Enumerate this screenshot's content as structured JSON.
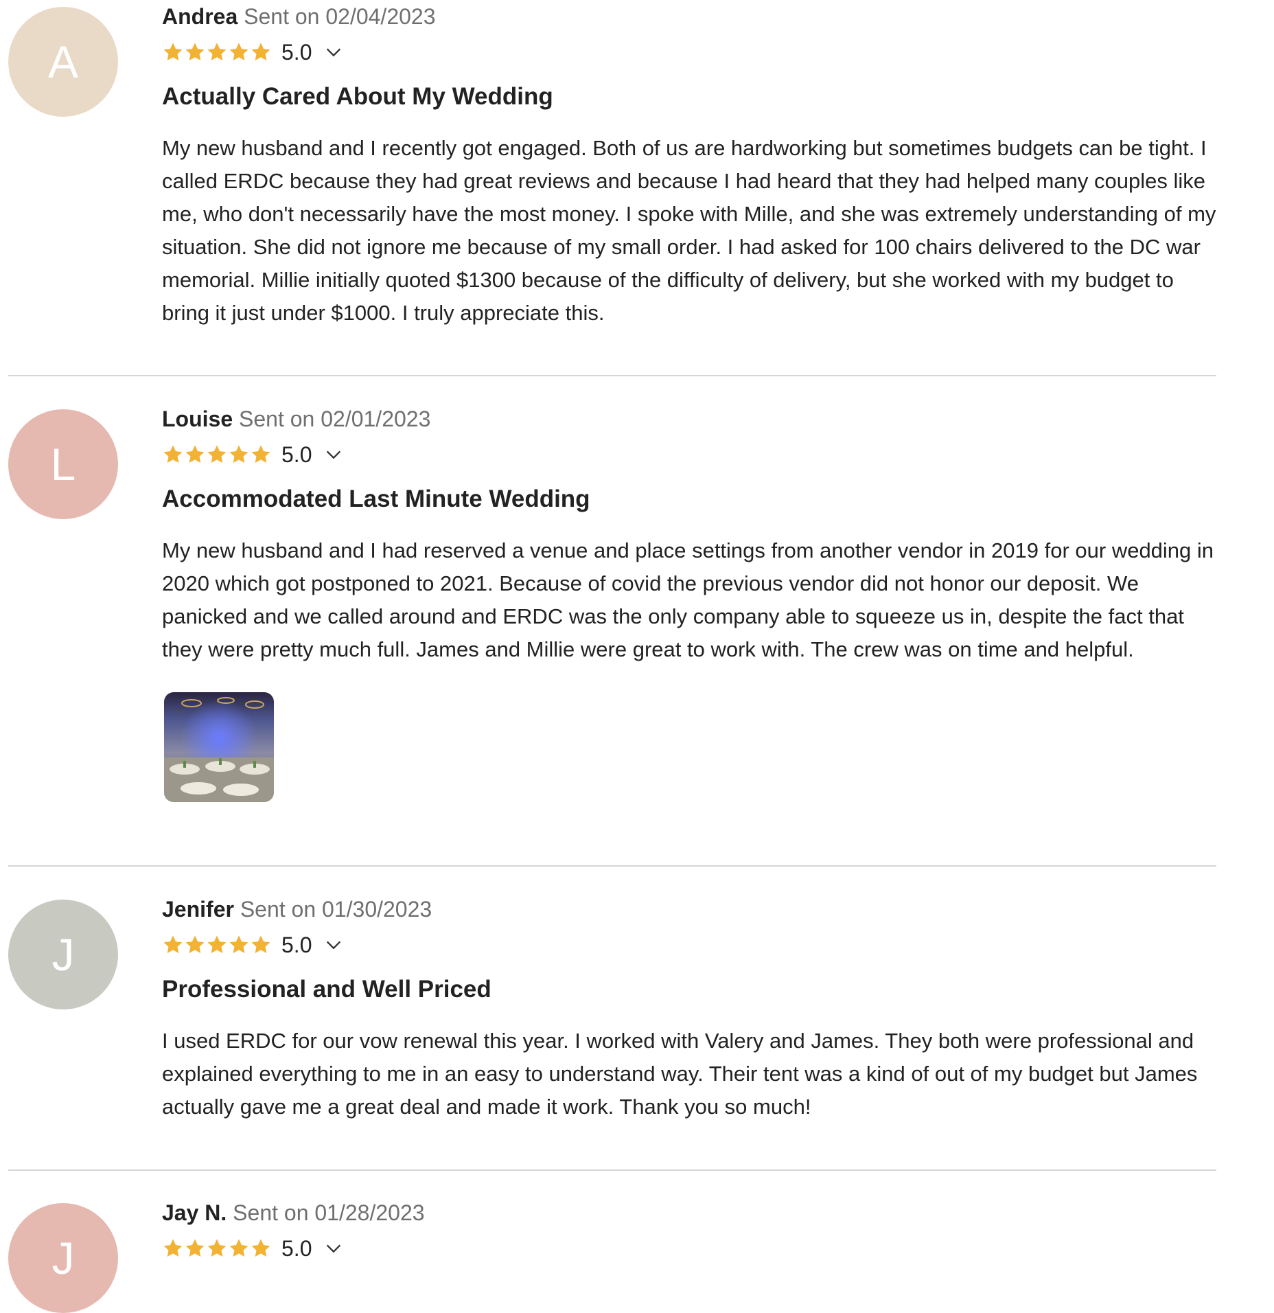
{
  "reviews": [
    {
      "initial": "A",
      "avatar_color": "#e9dac7",
      "author": "Andrea",
      "sent_label": "Sent on",
      "date": "02/04/2023",
      "rating": "5.0",
      "stars": 5,
      "title": "Actually Cared About My Wedding",
      "body": "My new husband and I recently got engaged. Both of us are hardworking but sometimes budgets can be tight. I called ERDC because they had great reviews and because I had heard that they had helped many couples like me, who don't necessarily have the most money. I spoke with Mille, and she was extremely understanding of my situation. She did not ignore me because of my small order. I had asked for 100 chairs delivered to the DC war memorial. Millie initially quoted $1300 because of the difficulty of delivery, but she worked with my budget to bring it just under $1000. I truly appreciate this."
    },
    {
      "initial": "L",
      "avatar_color": "#e5b8b0",
      "author": "Louise",
      "sent_label": "Sent on",
      "date": "02/01/2023",
      "rating": "5.0",
      "stars": 5,
      "title": "Accommodated Last Minute Wedding",
      "body": "My new husband and I had reserved a venue and place settings from another vendor in 2019 for our wedding in 2020 which got postponed to 2021. Because of covid the previous vendor did not honor our deposit. We panicked and we called around and ERDC was the only company able to squeeze us in, despite the fact that they were pretty much full. James and Millie were great to work with. The crew was on time and helpful."
    },
    {
      "initial": "J",
      "avatar_color": "#c8c9c1",
      "author": "Jenifer",
      "sent_label": "Sent on",
      "date": "01/30/2023",
      "rating": "5.0",
      "stars": 5,
      "title": "Professional and Well Priced",
      "body": "I used ERDC for our vow renewal this year. I worked with Valery and James. They both were professional and explained everything to me in an easy to understand way. Their tent was a kind of out of my budget but James actually gave me a great deal and made it work. Thank you so much!"
    },
    {
      "initial": "J",
      "avatar_color": "#e5b8b0",
      "author": "Jay N.",
      "sent_label": "Sent on",
      "date": "01/28/2023",
      "rating": "5.0",
      "stars": 5
    }
  ],
  "star_color": "#f2b233",
  "icons": {
    "star": "star-icon",
    "expand": "chevron-down-icon"
  }
}
